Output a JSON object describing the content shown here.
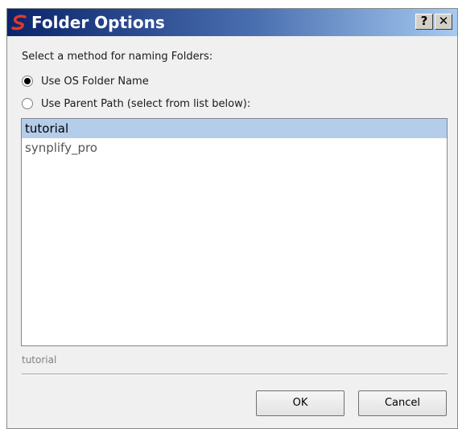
{
  "window": {
    "title": "Folder Options",
    "help_label": "?",
    "close_label": "✕"
  },
  "naming": {
    "prompt": "Select a method for naming Folders:",
    "options": [
      {
        "label": "Use OS Folder Name",
        "checked": true
      },
      {
        "label": "Use Parent Path (select from list below):",
        "checked": false
      }
    ]
  },
  "folder_list": {
    "items": [
      {
        "label": "tutorial",
        "selected": true
      },
      {
        "label": "synplify_pro",
        "selected": false
      }
    ]
  },
  "selection": {
    "value": "tutorial"
  },
  "buttons": {
    "ok_label": "OK",
    "cancel_label": "Cancel"
  },
  "colors": {
    "title_gradient_start": "#0a246a",
    "title_gradient_end": "#a6caf0",
    "selection_highlight": "#b4cdea",
    "logo_red": "#e03a2a"
  },
  "icons": {
    "app": "synplify-logo-icon",
    "help": "help-icon",
    "close": "close-icon"
  }
}
